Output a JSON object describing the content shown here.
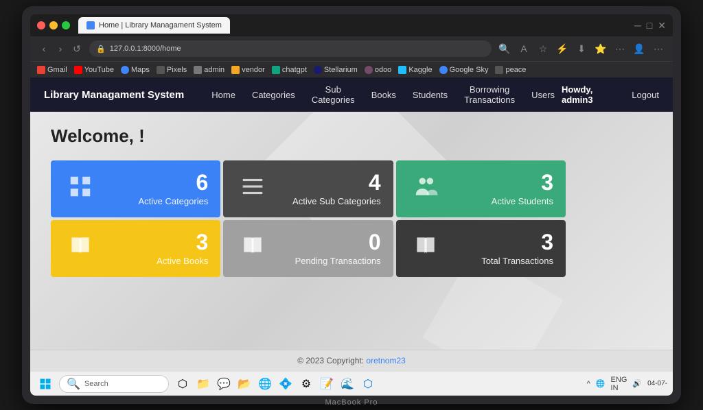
{
  "browser": {
    "tab_title": "Home | Library Managament System",
    "url": "127.0.0.1:8000/home",
    "bookmarks": [
      {
        "label": "Gmail",
        "color": "#ea4335"
      },
      {
        "label": "YouTube",
        "color": "#ff0000"
      },
      {
        "label": "Maps",
        "color": "#4285f4"
      },
      {
        "label": "Pixels",
        "color": "#555"
      },
      {
        "label": "admin",
        "color": "#555"
      },
      {
        "label": "vendor",
        "color": "#555"
      },
      {
        "label": "chatgpt",
        "color": "#10a37f"
      },
      {
        "label": "Stellarium",
        "color": "#1a1a6e"
      },
      {
        "label": "odoo",
        "color": "#714b67"
      },
      {
        "label": "Kaggle",
        "color": "#20beff"
      },
      {
        "label": "Google Sky",
        "color": "#4285f4"
      },
      {
        "label": "peace",
        "color": "#555"
      }
    ]
  },
  "site": {
    "logo": "Library Managament System",
    "nav": {
      "items": [
        {
          "label": "Home"
        },
        {
          "label": "Categories"
        },
        {
          "label": "Sub Categories"
        },
        {
          "label": "Books"
        },
        {
          "label": "Students"
        },
        {
          "label": "Borrowing Transactions"
        },
        {
          "label": "Users"
        }
      ]
    },
    "user_greeting": "Howdy, admin3",
    "logout_label": "Logout"
  },
  "welcome": {
    "heading": "Welcome,  !"
  },
  "stats": [
    {
      "id": "active-categories",
      "value": "6",
      "label": "Active Categories",
      "card_class": "card-blue",
      "icon": "▦"
    },
    {
      "id": "active-sub-categories",
      "value": "4",
      "label": "Active Sub Categories",
      "card_class": "card-dark-gray",
      "icon": "☰"
    },
    {
      "id": "active-students",
      "value": "3",
      "label": "Active Students",
      "card_class": "card-green",
      "icon": "👥"
    },
    {
      "id": "active-books",
      "value": "3",
      "label": "Active Books",
      "card_class": "card-yellow",
      "icon": "📖"
    },
    {
      "id": "pending-transactions",
      "value": "0",
      "label": "Pending Transactions",
      "card_class": "card-light-gray",
      "icon": "📚"
    },
    {
      "id": "total-transactions",
      "value": "3",
      "label": "Total Transactions",
      "card_class": "card-dark",
      "icon": "📚"
    }
  ],
  "footer": {
    "text": "© 2023 Copyright: ",
    "link_text": "oretnom23",
    "link_href": "#"
  },
  "taskbar": {
    "search_placeholder": "Search",
    "time": "04-07-",
    "language": "ENG\nIN"
  },
  "macbook": {
    "label": "MacBook Pro"
  }
}
